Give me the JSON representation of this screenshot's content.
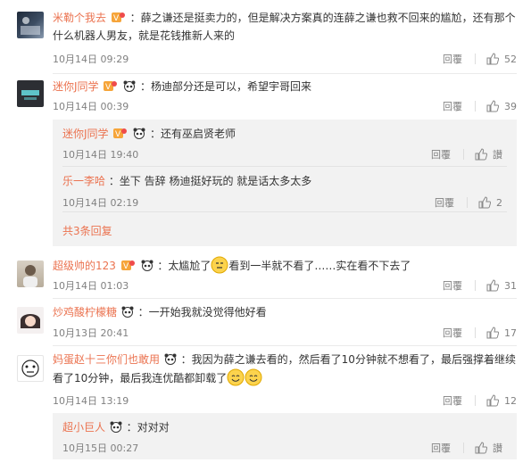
{
  "colors": {
    "name": "#eb7350",
    "meta": "#808080",
    "text": "#333333",
    "subbg": "#f2f2f2"
  },
  "comments": [
    {
      "user": "米勒个我去",
      "text": "：薛之谦还是挺卖力的，但是解决方案真的连薛之谦也救不回来的尴尬，还有那个什么机器人男友，就是花钱推新人来的",
      "time": "10月14日 09:29",
      "reply": "回覆",
      "likes": "52"
    },
    {
      "user": "迷你J同学",
      "text": "：杨迪部分还是可以，希望宇哥回来",
      "time": "10月14日 00:39",
      "reply": "回覆",
      "likes": "39",
      "subs": [
        {
          "user": "迷你J同学",
          "text": "：还有巫启贤老师",
          "time": "10月14日 19:40",
          "reply": "回覆",
          "likes": "讃"
        },
        {
          "user": "乐一李哈",
          "text": "：坐下 告辞 杨迪挺好玩的 就是话太多太多",
          "time": "10月14日 02:19",
          "reply": "回覆",
          "likes": "2"
        }
      ],
      "more": "共3条回复"
    },
    {
      "user": "超级帅的123",
      "text_a": "：太尴尬了",
      "text_b": "看到一半就不看了……实在看不下去了",
      "time": "10月14日 01:03",
      "reply": "回覆",
      "likes": "31"
    },
    {
      "user": "炒鸡酸柠檬糖",
      "text": "：一开始我就没觉得他好看",
      "time": "10月13日 20:41",
      "reply": "回覆",
      "likes": "17"
    },
    {
      "user": "妈蛋赵十三你们也敢用",
      "text": "：我因为薛之谦去看的，然后看了10分钟就不想看了，最后强撑着继续看了10分钟，最后我连优酷都卸载了",
      "time": "10月14日 13:19",
      "reply": "回覆",
      "likes": "12",
      "subs": [
        {
          "user": "超小巨人",
          "text": "：对对对",
          "time": "10月15日 00:27",
          "reply": "回覆",
          "likes": "讃"
        }
      ]
    }
  ]
}
